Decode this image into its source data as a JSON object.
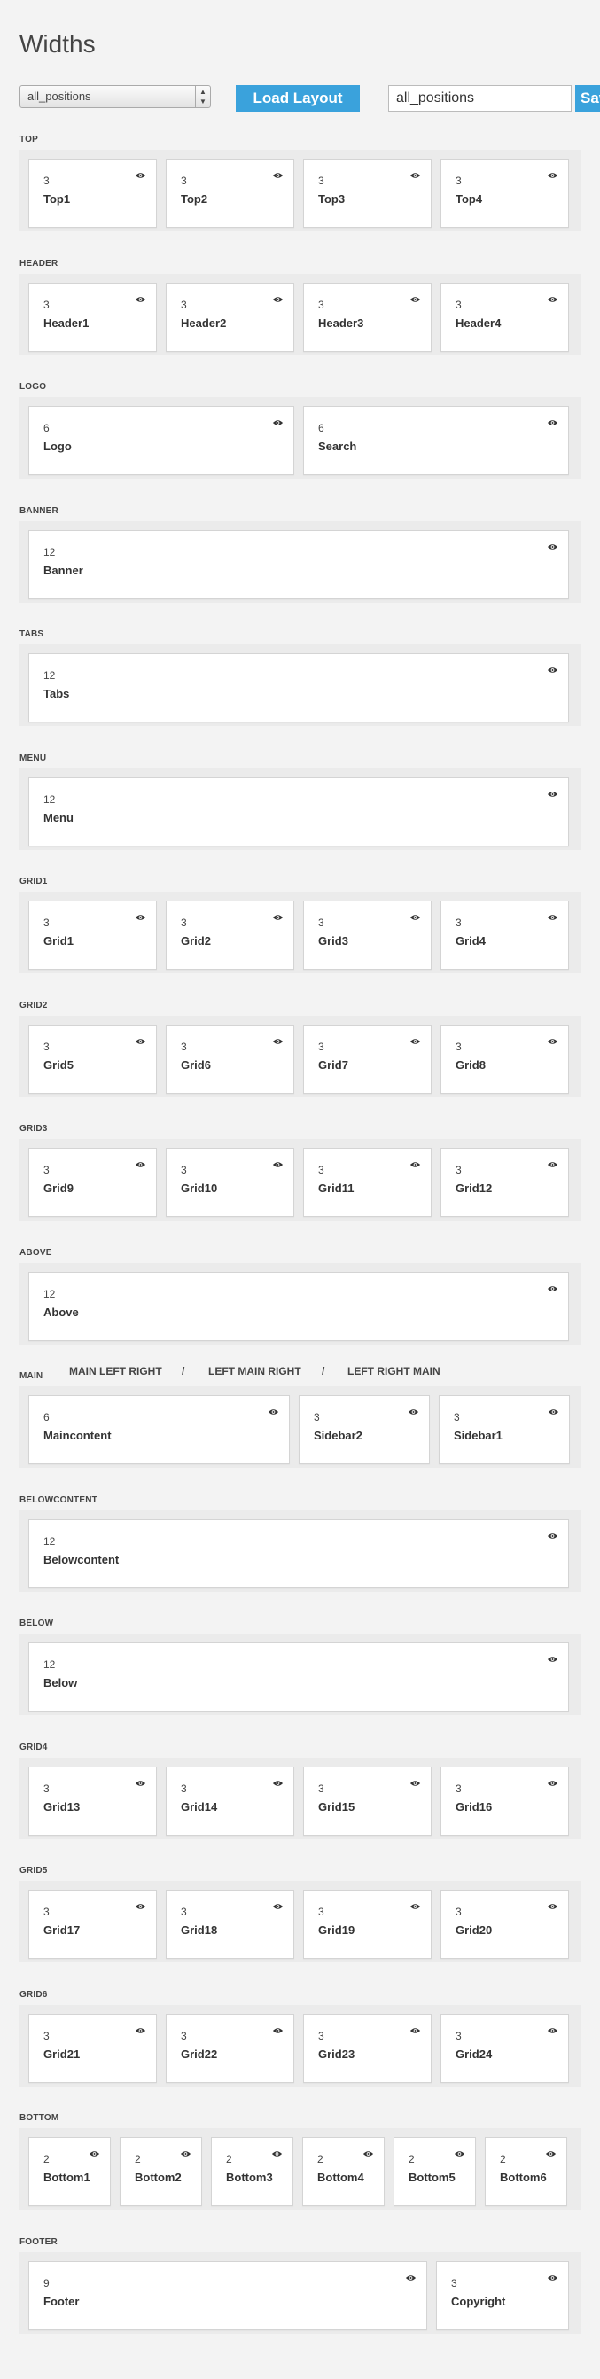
{
  "title": "Widths",
  "toolbar": {
    "layout_select_value": "all_positions",
    "load_button": "Load Layout",
    "name_input_value": "all_positions",
    "save_button": "Save"
  },
  "main_layout_options": [
    "MAIN LEFT RIGHT",
    "/",
    "LEFT MAIN RIGHT",
    "/",
    "LEFT RIGHT MAIN"
  ],
  "icons": {
    "visibility": "eye-icon"
  },
  "sections": [
    {
      "label": "TOP",
      "positions": [
        {
          "width": "3",
          "name": "Top1"
        },
        {
          "width": "3",
          "name": "Top2"
        },
        {
          "width": "3",
          "name": "Top3"
        },
        {
          "width": "3",
          "name": "Top4"
        }
      ]
    },
    {
      "label": "HEADER",
      "positions": [
        {
          "width": "3",
          "name": "Header1"
        },
        {
          "width": "3",
          "name": "Header2"
        },
        {
          "width": "3",
          "name": "Header3"
        },
        {
          "width": "3",
          "name": "Header4"
        }
      ]
    },
    {
      "label": "LOGO",
      "positions": [
        {
          "width": "6",
          "name": "Logo"
        },
        {
          "width": "6",
          "name": "Search"
        }
      ]
    },
    {
      "label": "BANNER",
      "positions": [
        {
          "width": "12",
          "name": "Banner"
        }
      ]
    },
    {
      "label": "TABS",
      "positions": [
        {
          "width": "12",
          "name": "Tabs"
        }
      ]
    },
    {
      "label": "MENU",
      "positions": [
        {
          "width": "12",
          "name": "Menu"
        }
      ]
    },
    {
      "label": "GRID1",
      "positions": [
        {
          "width": "3",
          "name": "Grid1"
        },
        {
          "width": "3",
          "name": "Grid2"
        },
        {
          "width": "3",
          "name": "Grid3"
        },
        {
          "width": "3",
          "name": "Grid4"
        }
      ]
    },
    {
      "label": "GRID2",
      "positions": [
        {
          "width": "3",
          "name": "Grid5"
        },
        {
          "width": "3",
          "name": "Grid6"
        },
        {
          "width": "3",
          "name": "Grid7"
        },
        {
          "width": "3",
          "name": "Grid8"
        }
      ]
    },
    {
      "label": "GRID3",
      "positions": [
        {
          "width": "3",
          "name": "Grid9"
        },
        {
          "width": "3",
          "name": "Grid10"
        },
        {
          "width": "3",
          "name": "Grid11"
        },
        {
          "width": "3",
          "name": "Grid12"
        }
      ]
    },
    {
      "label": "ABOVE",
      "positions": [
        {
          "width": "12",
          "name": "Above"
        }
      ]
    },
    {
      "label": "MAIN",
      "positions": [
        {
          "width": "6",
          "name": "Maincontent"
        },
        {
          "width": "3",
          "name": "Sidebar2"
        },
        {
          "width": "3",
          "name": "Sidebar1"
        }
      ]
    },
    {
      "label": "BELOWCONTENT",
      "positions": [
        {
          "width": "12",
          "name": "Belowcontent"
        }
      ]
    },
    {
      "label": "BELOW",
      "positions": [
        {
          "width": "12",
          "name": "Below"
        }
      ]
    },
    {
      "label": "GRID4",
      "positions": [
        {
          "width": "3",
          "name": "Grid13"
        },
        {
          "width": "3",
          "name": "Grid14"
        },
        {
          "width": "3",
          "name": "Grid15"
        },
        {
          "width": "3",
          "name": "Grid16"
        }
      ]
    },
    {
      "label": "GRID5",
      "positions": [
        {
          "width": "3",
          "name": "Grid17"
        },
        {
          "width": "3",
          "name": "Grid18"
        },
        {
          "width": "3",
          "name": "Grid19"
        },
        {
          "width": "3",
          "name": "Grid20"
        }
      ]
    },
    {
      "label": "GRID6",
      "positions": [
        {
          "width": "3",
          "name": "Grid21"
        },
        {
          "width": "3",
          "name": "Grid22"
        },
        {
          "width": "3",
          "name": "Grid23"
        },
        {
          "width": "3",
          "name": "Grid24"
        }
      ]
    },
    {
      "label": "BOTTOM",
      "positions": [
        {
          "width": "2",
          "name": "Bottom1"
        },
        {
          "width": "2",
          "name": "Bottom2"
        },
        {
          "width": "2",
          "name": "Bottom3"
        },
        {
          "width": "2",
          "name": "Bottom4"
        },
        {
          "width": "2",
          "name": "Bottom5"
        },
        {
          "width": "2",
          "name": "Bottom6"
        }
      ]
    },
    {
      "label": "FOOTER",
      "positions": [
        {
          "width": "9",
          "name": "Footer"
        },
        {
          "width": "3",
          "name": "Copyright"
        }
      ]
    }
  ]
}
